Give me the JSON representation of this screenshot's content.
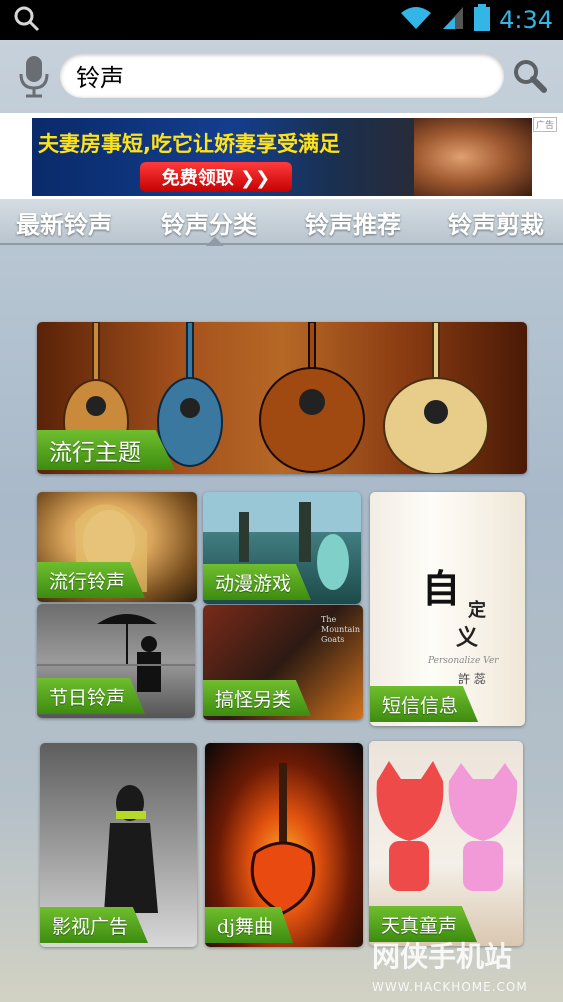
{
  "status_bar": {
    "time": "4:34",
    "accent_color": "#33b5e5",
    "icons": [
      "search-icon",
      "wifi-icon",
      "signal-icon",
      "battery-icon"
    ]
  },
  "search": {
    "value": "铃声",
    "mic_icon": "microphone-icon",
    "search_icon": "magnifier-icon"
  },
  "ad": {
    "headline": "夫妻房事短,吃它让娇妻享受满足",
    "button": "免费领取 ❯❯",
    "tag": "广告"
  },
  "tabs": [
    {
      "label": "最新铃声"
    },
    {
      "label": "铃声分类",
      "selected": true
    },
    {
      "label": "铃声推荐"
    },
    {
      "label": "铃声剪裁"
    }
  ],
  "categories": {
    "popular_theme": "流行主题",
    "popular_ringtones": "流行铃声",
    "anime_games": "动漫游戏",
    "sms_alerts": "短信信息",
    "holiday_ringtones": "节日铃声",
    "funny_other": "搞怪另类",
    "film_ads": "影视广告",
    "dj_dance": "dj舞曲",
    "children_songs": "天真童声"
  },
  "custom_card": {
    "char1": "自",
    "char2": "定",
    "char3": "义",
    "roman": "Personalize Ver",
    "author": "許 蕊"
  },
  "book_text": "The Mountain Goats",
  "label_color": "#4fa51a",
  "watermark": {
    "main": "网侠手机站",
    "sub": "WWW.HACKHOME.COM"
  }
}
